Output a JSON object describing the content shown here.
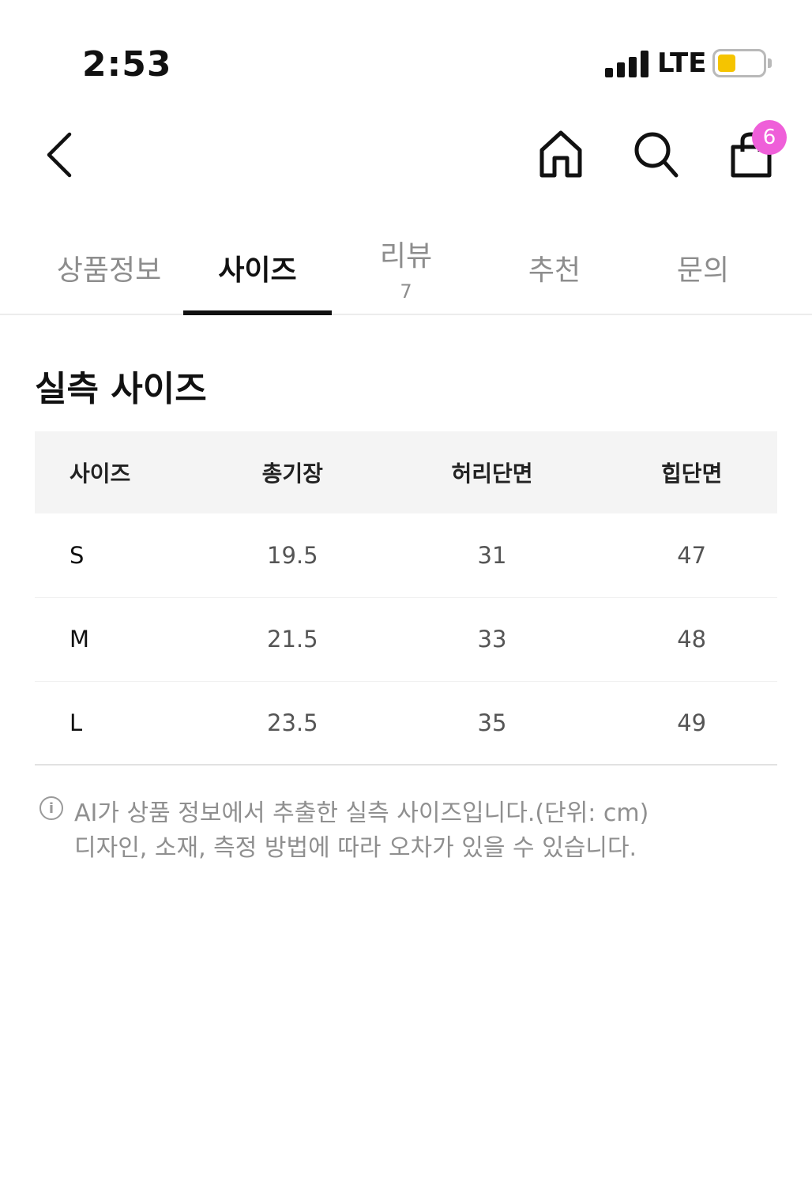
{
  "status_bar": {
    "time": "2:53",
    "network": "LTE",
    "battery_level": 0.3,
    "battery_color": "#f5c400"
  },
  "header": {
    "icons": [
      "back-arrow-icon",
      "home-icon",
      "search-icon",
      "shopping-bag-icon"
    ],
    "cart_badge_count": "6",
    "badge_color": "#ef5fd9"
  },
  "tabs": [
    {
      "label": "상품정보",
      "count": ""
    },
    {
      "label": "사이즈",
      "count": ""
    },
    {
      "label": "리뷰",
      "count": "7"
    },
    {
      "label": "추천",
      "count": ""
    },
    {
      "label": "문의",
      "count": ""
    }
  ],
  "active_tab": "사이즈",
  "section": {
    "title": "실측 사이즈"
  },
  "size_table": {
    "headers": [
      "사이즈",
      "총기장",
      "허리단면",
      "힙단면"
    ],
    "rows": [
      [
        "S",
        "19.5",
        "31",
        "47"
      ],
      [
        "M",
        "21.5",
        "33",
        "48"
      ],
      [
        "L",
        "23.5",
        "35",
        "49"
      ]
    ]
  },
  "note": {
    "icon": "info-icon",
    "icon_glyph": "i",
    "line1": "AI가 상품 정보에서 추출한 실측 사이즈입니다.(단위: cm)",
    "line2": "디자인, 소재, 측정 방법에 따라 오차가 있을 수 있습니다."
  }
}
